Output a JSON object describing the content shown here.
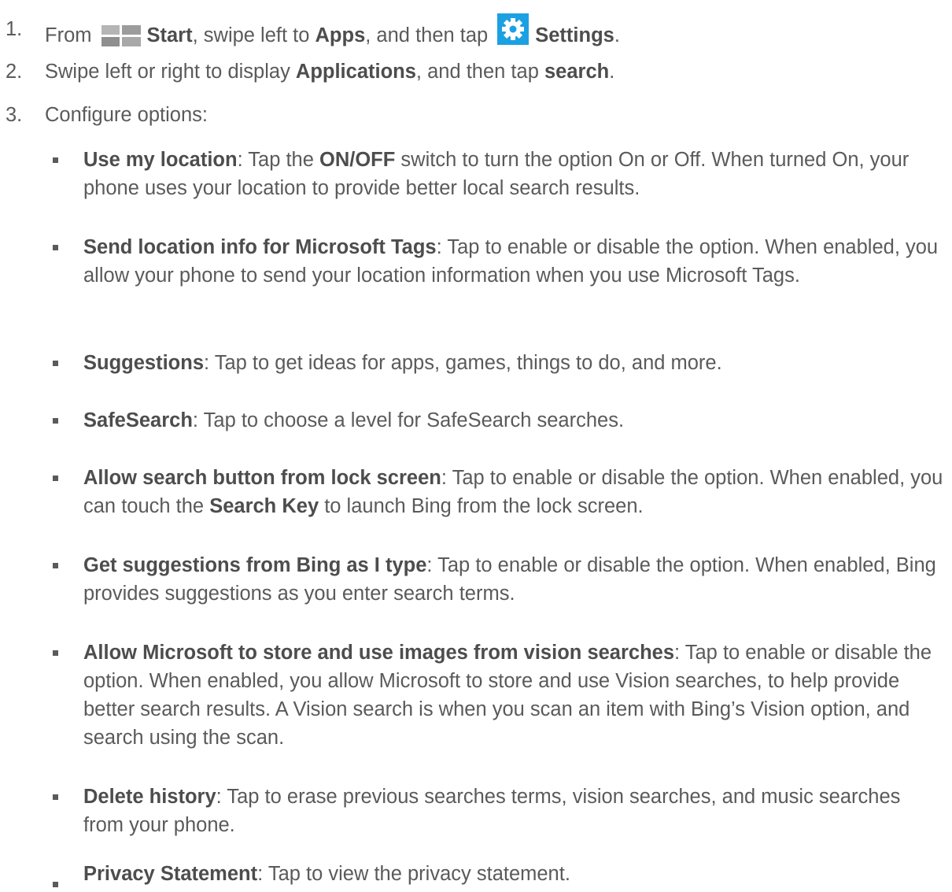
{
  "steps": [
    {
      "number": "1.",
      "parts": [
        "From",
        "Start",
        ", swipe left to ",
        "Apps",
        ", and then tap",
        "Settings",
        "."
      ],
      "icons": [
        "windows-start-icon",
        "settings-gear-icon"
      ]
    },
    {
      "number": "2.",
      "parts": [
        "Swipe left or right to display ",
        "Applications",
        ", and then tap ",
        "search",
        "."
      ]
    },
    {
      "number": "3.",
      "parts": [
        "Configure options:"
      ]
    }
  ],
  "options": [
    {
      "label": "Use my location",
      "t1": ": Tap the ",
      "b2": "ON/OFF",
      "t2": " switch to turn the option On or Off. When turned On, your phone uses your location to provide better local search results."
    },
    {
      "label": "Send location info for Microsoft Tags",
      "text": ": Tap to enable or disable the option. When enabled, you allow your phone to send your location information when you use Microsoft Tags."
    },
    {
      "label": "Suggestions",
      "text": ": Tap to get ideas for apps, games, things to do, and more."
    },
    {
      "label": "SafeSearch",
      "text": ": Tap to choose a level for SafeSearch searches."
    },
    {
      "label": "Allow search button from lock screen",
      "t1": ": Tap to enable or disable the option. When enabled, you can touch the ",
      "b2": "Search Key",
      "t2": " to launch Bing from the lock screen."
    },
    {
      "label": "Get suggestions from Bing as I type",
      "text": ": Tap to enable or disable the option. When enabled, Bing provides suggestions as you enter search terms."
    },
    {
      "label": "Allow Microsoft to store and use images from vision searches",
      "text": ": Tap to enable or disable the option. When enabled, you allow Microsoft to store and use Vision searches, to help provide better search results. A Vision search is when you scan an item with Bing’s Vision option, and search using the scan."
    },
    {
      "label": "Delete history",
      "text": ": Tap to erase previous searches terms, vision searches, and music searches from your phone."
    },
    {
      "label": "Privacy Statement",
      "text": ": Tap to view the privacy statement."
    }
  ],
  "colors": {
    "text": "#5a5a5a",
    "settings_icon_bg": "#1ba1e2",
    "windows_logo": "#a0a0a0"
  }
}
